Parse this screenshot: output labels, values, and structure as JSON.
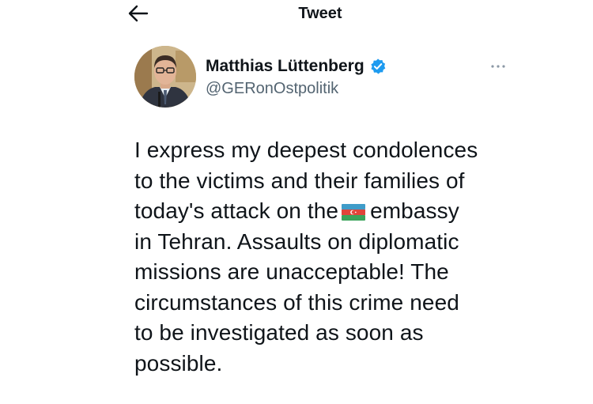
{
  "header": {
    "title": "Tweet",
    "back_icon": "arrow-left-icon"
  },
  "author": {
    "display_name": "Matthias Lüttenberg",
    "handle": "@GERonOstpolitik",
    "verified_icon": "verified-badge-icon",
    "avatar_icon": "avatar"
  },
  "menu": {
    "more_icon": "more-options-icon"
  },
  "tweet": {
    "line1": "I express my deepest condolences",
    "line2": "to the victims and their families of",
    "line3_before_flag": "today's attack on the",
    "flag_icon": "azerbaijan-flag-icon",
    "line3_after_flag": "embassy",
    "line4": "in Tehran. Assaults on diplomatic",
    "line5": "missions are unacceptable! The",
    "line6": "circumstances of this crime need",
    "line7": "to be investigated as soon as",
    "line8": "possible."
  },
  "colors": {
    "text_primary": "#0f1419",
    "text_secondary": "#536471",
    "verified_blue": "#1d9bf0",
    "flag_blue": "#3f9cc9",
    "flag_red": "#e0443a",
    "flag_green": "#3aa35a"
  }
}
